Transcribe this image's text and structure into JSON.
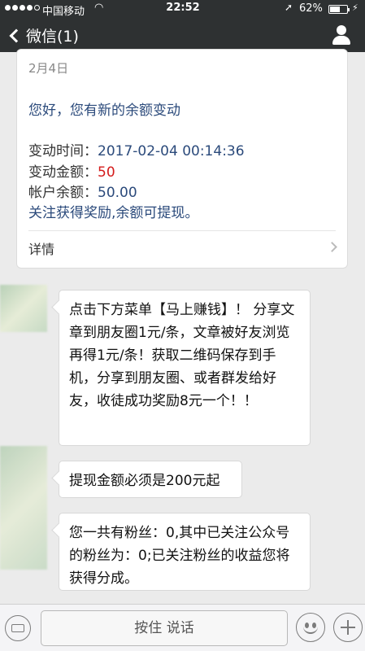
{
  "status_bar": {
    "carrier": "中国移动",
    "time": "22:52",
    "battery_text": "62%",
    "battery_level": 0.62
  },
  "nav": {
    "back_label": "微信(1)",
    "icons": {
      "back": "chevron-left-icon",
      "profile": "person-icon"
    }
  },
  "card": {
    "date": "2月4日",
    "greeting": "您好，您有新的余额变动",
    "rows": [
      {
        "label": "变动时间：",
        "value": "2017-02-04 00:14:36"
      },
      {
        "label": "变动金额：",
        "value": "50"
      },
      {
        "label": "帐户余额：",
        "value": "50.00"
      }
    ],
    "note": "关注获得奖励,余额可提现。",
    "detail_label": "详情",
    "amount_color": "#d41b1b"
  },
  "messages": [
    {
      "text": "点击下方菜单【马上赚钱】！ 分享文章到朋友圈1元/条，文章被好友浏览再得1元/条！获取二维码保存到手机，分享到朋友圈、或者群发给好友，收徒成功奖励8元一个！！"
    },
    {
      "text": "提现金额必须是200元起"
    },
    {
      "text": "您一共有粉丝：0,其中已关注公众号的粉丝为：0;已关注粉丝的收益您将获得分成。"
    }
  ],
  "input_bar": {
    "hold_to_talk": "按住 说话",
    "icons": {
      "keyboard": "keyboard-icon",
      "emoji": "emoji-icon",
      "plus": "plus-icon"
    }
  },
  "colors": {
    "nav_bg": "#2e3132",
    "link_blue": "#2b4a7b",
    "chat_bg": "#ebebeb"
  }
}
